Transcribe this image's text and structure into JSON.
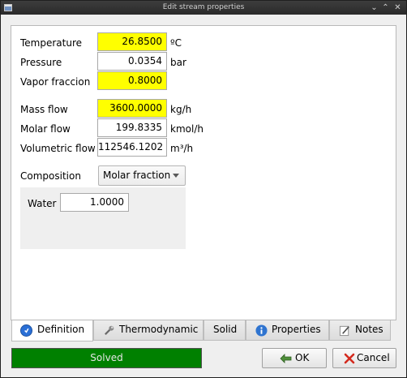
{
  "window": {
    "title": "Edit stream properties"
  },
  "conditions": {
    "temperature": {
      "label": "Temperature",
      "value": "26.8500",
      "unit": "ºC"
    },
    "pressure": {
      "label": "Pressure",
      "value": "0.0354",
      "unit": "bar"
    },
    "vapor": {
      "label": "Vapor fraccion",
      "value": "0.8000"
    }
  },
  "flows": {
    "mass": {
      "label": "Mass flow",
      "value": "3600.0000",
      "unit": "kg/h"
    },
    "molar": {
      "label": "Molar flow",
      "value": "199.8335",
      "unit": "kmol/h"
    },
    "volumetric": {
      "label": "Volumetric flow",
      "value": "112546.1202",
      "unit": "m³/h"
    }
  },
  "composition": {
    "label": "Composition",
    "mode": "Molar fraction",
    "components": [
      {
        "name": "Water",
        "value": "1.0000"
      }
    ]
  },
  "tabs": [
    {
      "label": "Definition",
      "icon": "info-blue-icon"
    },
    {
      "label": "Thermodynamic",
      "icon": "wrench-icon"
    },
    {
      "label": "Solid"
    },
    {
      "label": "Properties",
      "icon": "info-icon"
    },
    {
      "label": "Notes",
      "icon": "notes-pencil-icon"
    }
  ],
  "status": {
    "text": "Solved",
    "color": "#008000"
  },
  "buttons": {
    "ok": "OK",
    "cancel": "Cancel"
  }
}
